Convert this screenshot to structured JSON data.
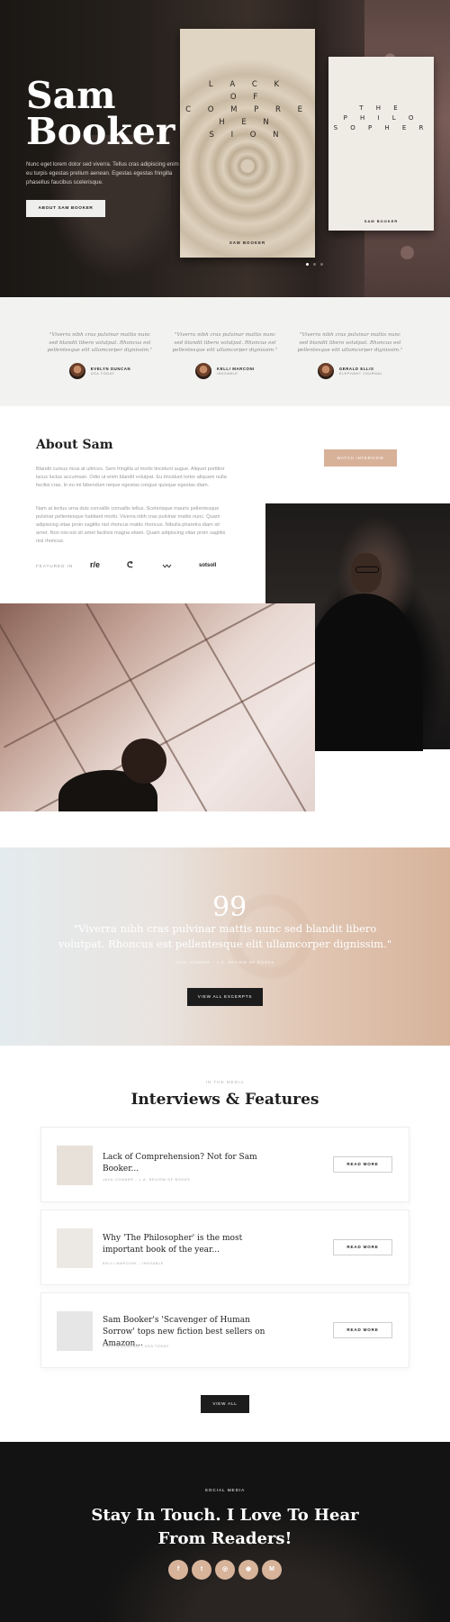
{
  "hero": {
    "title_line1": "Sam",
    "title_line2": "Booker",
    "description": "Nunc eget lorem dolor sed viverra. Tellus cras adipiscing enim eu turpis egestas pretium aenean. Egestas egestas fringilla phasellus faucibus scelerisque.",
    "button_label": "ABOUT SAM BOOKER",
    "book1": {
      "title_lines": [
        "L A C K",
        "O F",
        "C O M P R E",
        "H E N",
        "S I O N"
      ],
      "author": "SAM BOOKER"
    },
    "book2": {
      "title_lines": [
        "T H E",
        "P H I L O",
        "S O P H E R"
      ],
      "author": "SAM BOOKER"
    }
  },
  "testimonials": [
    {
      "quote": "\"Viverra nibh cras pulvinar mattis nunc sed blandit libero volutpat. Rhoncus est pellentesque elit ullamcorper dignissim.\"",
      "name": "EVELYN DUNCAN",
      "source": "USA TODAY"
    },
    {
      "quote": "\"Viverra nibh cras pulvinar mattis nunc sed blandit libero volutpat. Rhoncus est pellentesque elit ullamcorper dignissim.\"",
      "name": "KELLI MARCONI",
      "source": "INKSABLE"
    },
    {
      "quote": "\"Viverra nibh cras pulvinar mattis nunc sed blandit libero volutpat. Rhoncus est pellentesque elit ullamcorper dignissim.\"",
      "name": "GERALD ELLIS",
      "source": "ELEPHANT JOURNAL"
    }
  ],
  "about": {
    "title": "About Sam",
    "para1": "Blandit cursus risus at ultrices. Sem fringilla ut morbi tincidunt augue. Aliquet porttitor lacus luctus accumsan. Odio ut enim blandit volutpat. Eu tincidunt tortor aliquam nulla facilisi cras. In eu mi bibendum neque egestas congue quisque egestas diam.",
    "para2": "Nam at lectus urna duis convallis convallis tellus. Scelerisque mauris pellentesque pulvinar pellentesque habitant morbi. Viverra nibh cras pulvinar mattis nunc. Quam adipiscing vitae proin sagittis nisl rhoncus mattis rhoncus. Nibulla pharetra diam sit amet. Non nisi est sit amet facilisis magna etiam. Quam adipiscing vitae proin sagittis nisl rhoncus.",
    "watch_button": "WATCH INTERVIEW",
    "featured_label": "FEATURED IN",
    "logos": [
      "r/e",
      "ᕦ",
      "〰",
      "sotsoll"
    ]
  },
  "quote_banner": {
    "mark": "99",
    "text": "\"Viverra nibh cras pulvinar mattis nunc sed blandit libero volutpat. Rhoncus est pellentesque elit ullamcorper dignissim.\"",
    "source": "JACK CONNER – L.A. REVIEW OF BOOKS",
    "button": "VIEW ALL EXCERPTS"
  },
  "media": {
    "overline": "IN THE MEDIA",
    "title": "Interviews & Features",
    "items": [
      {
        "title": "Lack of Comprehension? Not for Sam Booker...",
        "meta": "JACK CONNER – L.A. REVIEW OF BOOKS",
        "button": "READ MORE"
      },
      {
        "title": "Why 'The Philosopher' is the most important book of the year...",
        "meta": "KELLI MARCONI – INKSABLE",
        "button": "READ MORE"
      },
      {
        "title": "Sam Booker's 'Scavenger of Human Sorrow' tops new fiction best sellers on Amazon...",
        "meta": "EVELYN DUNCAN – USA TODAY",
        "button": "READ MORE"
      }
    ],
    "view_all": "VIEW ALL"
  },
  "social": {
    "overline": "SOCIAL MEDIA",
    "title": "Stay In Touch. I Love To Hear From Readers!",
    "icons": [
      "f",
      "t",
      "◎",
      "◉",
      "M"
    ]
  },
  "colors": {
    "accent": "#d8b199",
    "dark": "#1c1c1c",
    "light_bg": "#f2f3f1"
  }
}
